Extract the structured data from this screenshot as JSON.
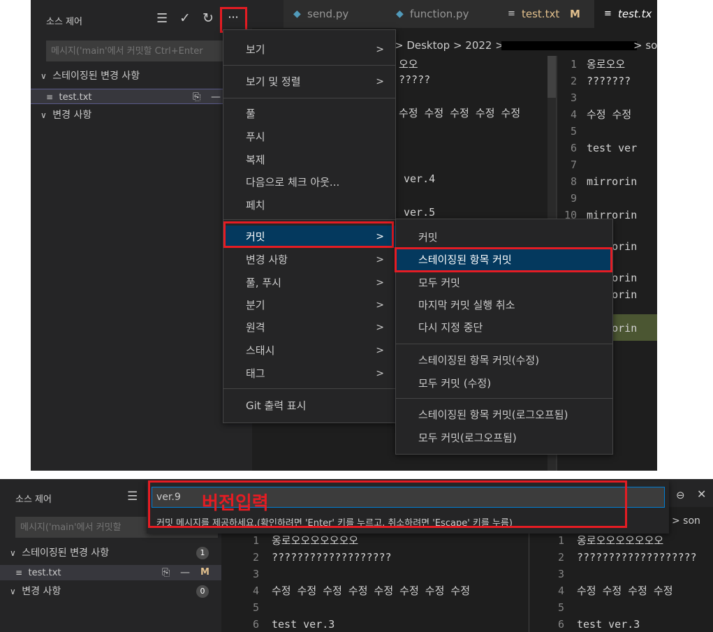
{
  "top": {
    "scm_title": "소스 제어",
    "toolbar_icons": [
      "list-tree-icon",
      "check-icon",
      "refresh-icon",
      "more-icon"
    ],
    "more_glyph": "···",
    "message_placeholder": "메시지('main'에서 커밋할 Ctrl+Enter",
    "staged_label": "스테이징된 변경 사항",
    "staged_file": "test.txt",
    "changes_label": "변경 사항",
    "tabs": [
      {
        "label": "send.py",
        "icon": "python-icon"
      },
      {
        "label": "function.py",
        "icon": "python-icon"
      },
      {
        "label": "test.txt",
        "modified": "M",
        "icon": "text-file-icon"
      },
      {
        "label": "test.tx",
        "icon": "text-file-icon"
      }
    ],
    "breadcrumb_left": "> Desktop > 2022 >",
    "breadcrumb_right": "> sou",
    "left_editor_lines": [
      "오오",
      "?????",
      "",
      "수정 수정 수정 수정 수정",
      "",
      "",
      "ver.4",
      "",
      "ver.5"
    ],
    "right_editor": {
      "numbers": [
        "1",
        "2",
        "3",
        "4",
        "5",
        "6",
        "7",
        "8",
        "9",
        "10"
      ],
      "lines": [
        "옹로오오",
        "???????",
        "",
        "수정 수정",
        "",
        "test ver",
        "",
        "mirrorin",
        "",
        "mirrorin"
      ],
      "extra_lines": [
        "mirrorin",
        "mirrorin",
        "mirrorin",
        "mirrorin"
      ]
    },
    "menu": [
      {
        "label": "보기",
        "arrow": ">"
      },
      {
        "label": "보기 및 정렬",
        "arrow": ">"
      },
      {
        "label": "풀"
      },
      {
        "label": "푸시"
      },
      {
        "label": "복제"
      },
      {
        "label": "다음으로 체크 아웃..."
      },
      {
        "label": "페치"
      },
      {
        "label": "커밋",
        "arrow": ">"
      },
      {
        "label": "변경 사항",
        "arrow": ">"
      },
      {
        "label": "풀, 푸시",
        "arrow": ">"
      },
      {
        "label": "분기",
        "arrow": ">"
      },
      {
        "label": "원격",
        "arrow": ">"
      },
      {
        "label": "스태시",
        "arrow": ">"
      },
      {
        "label": "태그",
        "arrow": ">"
      },
      {
        "label": "Git 출력 표시"
      }
    ],
    "submenu": [
      {
        "label": "커밋"
      },
      {
        "label": "스테이징된 항목 커밋"
      },
      {
        "label": "모두 커밋"
      },
      {
        "label": "마지막 커밋 실행 취소"
      },
      {
        "label": "다시 지정 중단"
      },
      {
        "label": "스테이징된 항목 커밋(수정)"
      },
      {
        "label": "모두 커밋 (수정)"
      },
      {
        "label": "스테이징된 항목 커밋(로그오프됨)"
      },
      {
        "label": "모두 커밋(로그오프됨)"
      }
    ]
  },
  "bottom": {
    "scm_title": "소스 제어",
    "message_placeholder": "메시지('main'에서 커밋할",
    "input_value": "ver.9",
    "annotation": "버전입력",
    "hint": "커밋 메시지를 제공하세요.(확인하려면 'Enter' 키를 누르고, 취소하려면 'Escape' 키를 누름)",
    "staged_label": "스테이징된 변경 사항",
    "staged_count": "1",
    "staged_file": "test.txt",
    "file_status": "M",
    "changes_label": "변경 사항",
    "changes_count": "0",
    "breadcrumb_right": "> son",
    "lock_icon": "lock-icon",
    "editor_left": {
      "numbers": [
        "1",
        "2",
        "3",
        "4",
        "5",
        "6"
      ],
      "lines": [
        "옹로오오오오오오오",
        "???????????????????",
        "",
        "수정 수정 수정 수정 수정 수정 수정 수정",
        "",
        "test ver.3"
      ]
    },
    "editor_right": {
      "numbers": [
        "1",
        "2",
        "3",
        "4",
        "5",
        "6"
      ],
      "lines": [
        "옹로오오오오오오오",
        "???????????????????",
        "",
        "수정 수정 수정 수정",
        "",
        "test ver.3"
      ]
    }
  }
}
